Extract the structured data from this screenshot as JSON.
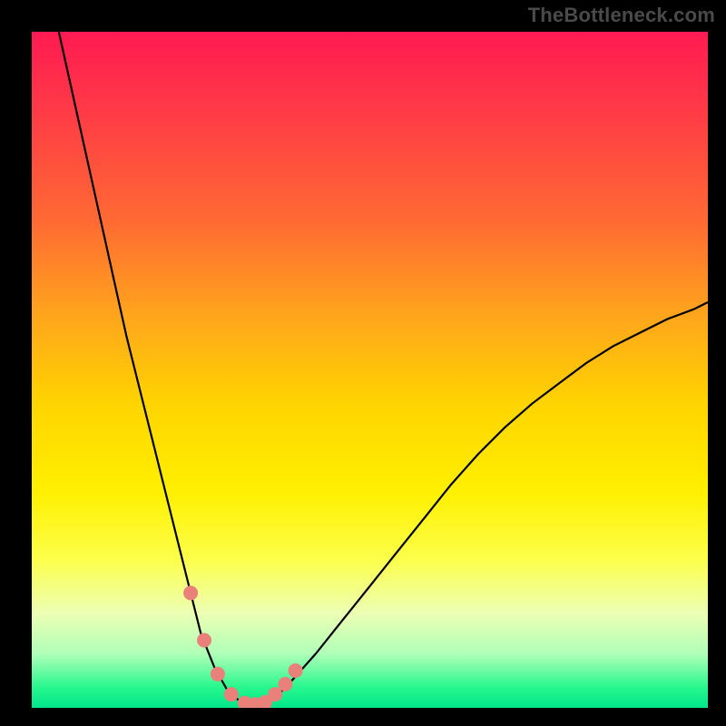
{
  "watermark": "TheBottleneck.com",
  "chart_data": {
    "type": "line",
    "title": "",
    "xlabel": "",
    "ylabel": "",
    "xlim": [
      0,
      100
    ],
    "ylim": [
      0,
      100
    ],
    "background_scale": {
      "type": "vertical-gradient",
      "meaning": "red=high bottleneck, green=low bottleneck",
      "stops": [
        {
          "pos": 0.0,
          "color": "#ff1a52"
        },
        {
          "pos": 0.12,
          "color": "#ff3b46"
        },
        {
          "pos": 0.28,
          "color": "#ff6a33"
        },
        {
          "pos": 0.42,
          "color": "#ffa51c"
        },
        {
          "pos": 0.55,
          "color": "#ffd400"
        },
        {
          "pos": 0.68,
          "color": "#fff000"
        },
        {
          "pos": 0.78,
          "color": "#fcff4a"
        },
        {
          "pos": 0.86,
          "color": "#ecffb4"
        },
        {
          "pos": 0.92,
          "color": "#b0ffb8"
        },
        {
          "pos": 0.97,
          "color": "#27f78e"
        },
        {
          "pos": 1.0,
          "color": "#00e68a"
        }
      ]
    },
    "series": [
      {
        "name": "bottleneck-curve",
        "color": "#000000",
        "x": [
          4,
          6,
          8,
          10,
          12,
          14,
          16,
          18,
          20,
          22,
          23.5,
          25,
          27,
          29,
          31,
          32.5,
          34,
          36,
          38,
          42,
          46,
          50,
          54,
          58,
          62,
          66,
          70,
          74,
          78,
          82,
          86,
          90,
          94,
          98,
          100
        ],
        "y": [
          100,
          91,
          82,
          73,
          64,
          55,
          47,
          39,
          31,
          23,
          17,
          11,
          6,
          2.5,
          0.8,
          0.3,
          0.5,
          1.5,
          3.5,
          8,
          13,
          18,
          23,
          28,
          33,
          37.5,
          41.5,
          45,
          48,
          51,
          53.5,
          55.5,
          57.5,
          59,
          60
        ]
      },
      {
        "name": "highlight-markers",
        "color": "#e98079",
        "marker": "circle",
        "x": [
          23.5,
          25.5,
          27.5,
          29.5,
          31.5,
          33,
          34.5,
          36,
          37.5,
          39
        ],
        "y": [
          17,
          10,
          5,
          2,
          0.7,
          0.5,
          0.8,
          2,
          3.5,
          5.5
        ]
      }
    ]
  }
}
